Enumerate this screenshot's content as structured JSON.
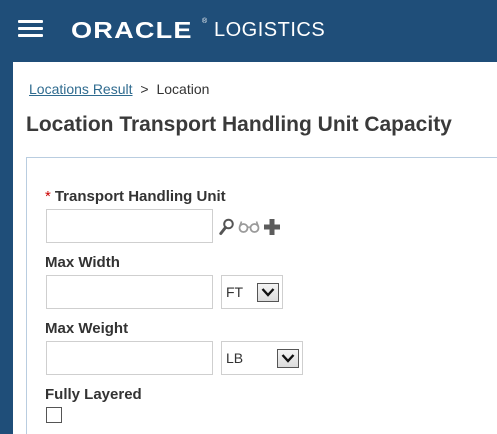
{
  "header": {
    "brand_logo": "ORACLE",
    "brand_registered": "®",
    "app_name": "LOGISTICS",
    "menu_icon": "hamburger-menu-icon"
  },
  "breadcrumb": {
    "parent_link": "Locations Result",
    "separator": ">",
    "current": "Location"
  },
  "page": {
    "title": "Location Transport Handling Unit Capacity"
  },
  "form": {
    "transport_handling_unit": {
      "required_marker": "*",
      "label": "Transport Handling Unit",
      "value": "",
      "icons": [
        "search-icon",
        "view-glasses-icon",
        "add-plus-icon"
      ]
    },
    "max_width": {
      "label": "Max Width",
      "value": "",
      "unit_selected": "FT"
    },
    "max_weight": {
      "label": "Max Weight",
      "value": "",
      "unit_selected": "LB"
    },
    "fully_layered": {
      "label": "Fully Layered",
      "checked": false
    }
  },
  "colors": {
    "header_bg": "#1f4e79",
    "link": "#2f6b8f",
    "required": "#cc0000",
    "panel_border": "#b9cde0"
  }
}
